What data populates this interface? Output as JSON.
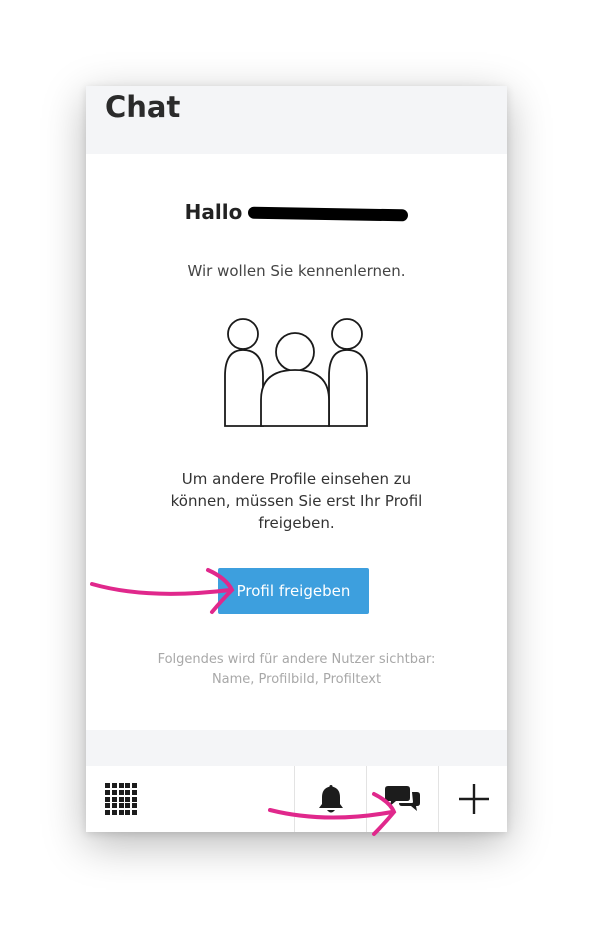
{
  "header": {
    "title": "Chat"
  },
  "card": {
    "greeting": "Hallo",
    "intro": "Wir wollen Sie kennenlernen.",
    "description": "Um andere Profile einsehen zu können, müssen Sie erst Ihr Profil freigeben.",
    "button_label": "Profil freigeben",
    "note": "Folgendes wird für andere Nutzer sichtbar: Name, Profilbild, Profiltext"
  },
  "bottom_nav": {
    "items": [
      {
        "icon": "apps-grid-icon"
      },
      {
        "icon": "bell-icon"
      },
      {
        "icon": "chat-icon"
      },
      {
        "icon": "plus-icon"
      }
    ]
  },
  "colors": {
    "primary_button": "#3d9fde",
    "annotation_arrow": "#e0288c",
    "background": "#f4f5f7"
  }
}
